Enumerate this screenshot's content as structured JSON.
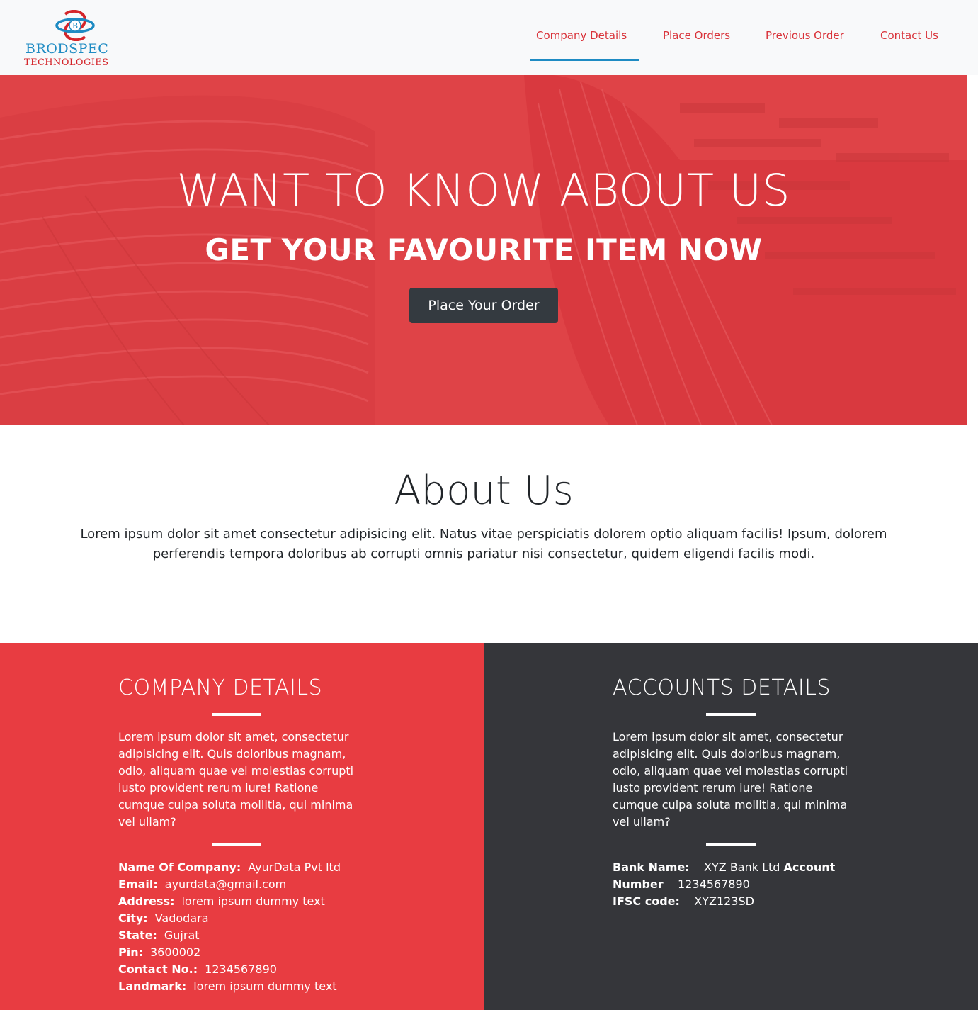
{
  "navbar": {
    "logo": {
      "mark_letter": "B",
      "brand": "BRODSPEC",
      "sub": "TECHNOLOGIES",
      "icon": "brodspec-logo-icon"
    },
    "items": [
      {
        "label": "Company Details",
        "active": true
      },
      {
        "label": "Place Orders",
        "active": false
      },
      {
        "label": "Previous Order",
        "active": false
      },
      {
        "label": "Contact Us",
        "active": false
      }
    ]
  },
  "hero": {
    "title": "WANT TO KNOW ABOUT US",
    "subtitle": "GET YOUR FAVOURITE ITEM NOW",
    "button_label": "Place Your Order"
  },
  "about": {
    "title": "About Us",
    "text_line1": "Lorem ipsum dolor sit amet consectetur adipisicing elit. Natus vitae perspiciatis dolorem optio aliquam facilis! Ipsum, dolorem",
    "text_line2": "perferendis tempora doloribus ab corrupti omnis pariatur nisi consectetur, quidem eligendi facilis modi."
  },
  "company_details": {
    "heading": "COMPANY DETAILS",
    "text": "Lorem ipsum dolor sit amet, consectetur adipisicing elit. Quis doloribus magnam, odio, aliquam quae vel molestias corrupti iusto provident rerum iure! Ratione cumque culpa soluta mollitia, qui minima vel ullam?",
    "fields": [
      {
        "label": "Name Of Company:",
        "value": "AyurData Pvt ltd"
      },
      {
        "label": "Email:",
        "value": "ayurdata@gmail.com"
      },
      {
        "label": "Address:",
        "value": "lorem ipsum dummy text"
      },
      {
        "label": "City:",
        "value": "Vadodara"
      },
      {
        "label": "State:",
        "value": "Gujrat"
      },
      {
        "label": "Pin:",
        "value": "3600002"
      },
      {
        "label": "Contact No.:",
        "value": "1234567890"
      },
      {
        "label": "Landmark:",
        "value": "lorem ipsum dummy text"
      }
    ]
  },
  "accounts_details": {
    "heading": "ACCOUNTS DETAILS",
    "text": "Lorem ipsum dolor sit amet, consectetur adipisicing elit. Quis doloribus magnam, odio, aliquam quae vel molestias corrupti iusto provident rerum iure! Ratione cumque culpa soluta mollitia, qui minima vel ullam?",
    "bank_label": "Bank Name:",
    "bank_value": "XYZ Bank Ltd",
    "account_label_1": "Account",
    "account_label_2": "Number",
    "account_value": "1234567890",
    "ifsc_label": "IFSC code:",
    "ifsc_value": "XYZ123SD"
  },
  "colors": {
    "accent_red": "#e83c41",
    "nav_text": "#d9333a",
    "active_underline": "#1e8bc3",
    "dark": "#35363a",
    "button_dark": "#343a40"
  }
}
